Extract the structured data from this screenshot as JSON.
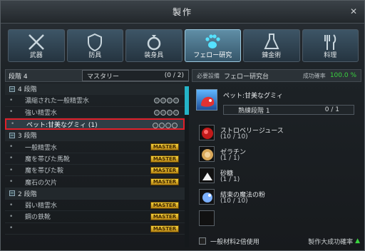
{
  "window": {
    "title": "製作"
  },
  "tabs": [
    {
      "label": "武器",
      "icon": "crossed-swords-icon",
      "active": false
    },
    {
      "label": "防具",
      "icon": "shield-icon",
      "active": false
    },
    {
      "label": "装身具",
      "icon": "ring-icon",
      "active": false
    },
    {
      "label": "フェロー研究",
      "icon": "paw-icon",
      "active": true
    },
    {
      "label": "錬金術",
      "icon": "flask-icon",
      "active": false
    },
    {
      "label": "料理",
      "icon": "fork-knife-icon",
      "active": false
    }
  ],
  "left": {
    "level_label": "段階 4",
    "mastery_label": "マスタリー",
    "mastery_value": "(0 / 2)",
    "rows": [
      {
        "type": "group",
        "label": "4 段階"
      },
      {
        "type": "item",
        "label": "濃縮された一般精霊水",
        "badge": "circles"
      },
      {
        "type": "item",
        "label": "強い精霊水",
        "badge": "circles"
      },
      {
        "type": "item",
        "label": "ペット:甘美なグミィ (1)",
        "badge": "circles",
        "selected": true
      },
      {
        "type": "group",
        "label": "3 段階"
      },
      {
        "type": "item",
        "label": "一般精霊水",
        "badge": "MASTER"
      },
      {
        "type": "item",
        "label": "魔を帯びた馬靴",
        "badge": "MASTER"
      },
      {
        "type": "item",
        "label": "魔を帯びた鞍",
        "badge": "MASTER"
      },
      {
        "type": "item",
        "label": "魔石の欠片",
        "badge": "MASTER"
      },
      {
        "type": "group",
        "label": "2 段階"
      },
      {
        "type": "item",
        "label": "弱い精霊水",
        "badge": "MASTER"
      },
      {
        "type": "item",
        "label": "鋼の鉄靴",
        "badge": "MASTER"
      },
      {
        "type": "item",
        "label": "",
        "badge": "MASTER"
      }
    ]
  },
  "right": {
    "required_label": "必要設備",
    "required_value": "フェロー研究台",
    "rate_label": "成功確率",
    "rate_value": "100.0 %",
    "item_name": "ペット:甘美なグミィ",
    "skill_label": "熟練段階 1",
    "skill_value": "0 / 1",
    "materials": [
      {
        "name": "ストロベリージュース",
        "qty": "(10 / 10)",
        "icon": "red-orb-icon"
      },
      {
        "name": "ゼラチン",
        "qty": "(1 / 1)",
        "icon": "gelatin-icon"
      },
      {
        "name": "砂糖",
        "qty": "(1 / 1)",
        "icon": "sugar-icon"
      },
      {
        "name": "結束の魔法の粉",
        "qty": "(10 / 10)",
        "icon": "magic-powder-icon"
      },
      {
        "name": "",
        "qty": "",
        "icon": "empty-slot-icon"
      }
    ],
    "footer_check": "一般材料2倍使用",
    "footer_rate": "製作大成功確率"
  }
}
